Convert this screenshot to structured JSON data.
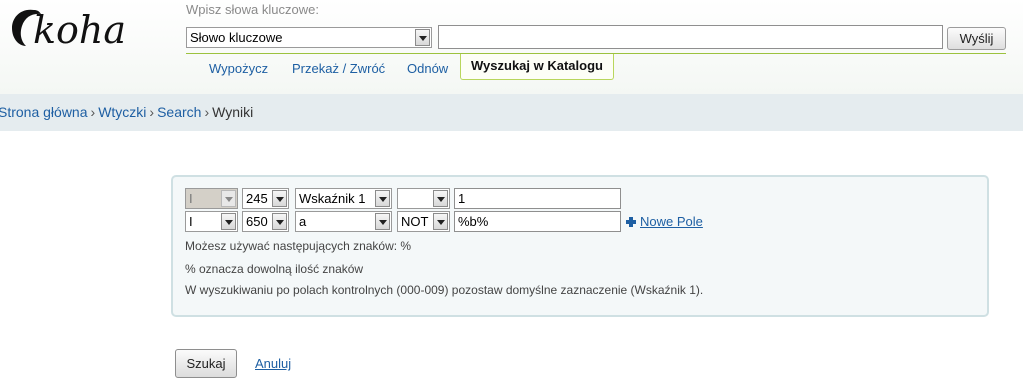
{
  "header": {
    "logo_text": "koha",
    "search_hint": "Wpisz słowa kluczowe:",
    "search_type_selected": "Słowo kluczowe",
    "keyword_value": "",
    "submit_label": "Wyślij",
    "tabs": [
      "Wypożycz",
      "Przekaż / Zwróć",
      "Odnów",
      "Wyszukaj w Katalogu"
    ],
    "active_tab": "Wyszukaj w Katalogu"
  },
  "breadcrumb": {
    "items": [
      "Strona główna",
      "Wtyczki",
      "Search"
    ],
    "current": "Wyniki",
    "separator": "›"
  },
  "criteria": [
    {
      "logic": "I",
      "logic_disabled": true,
      "field": "245",
      "subfield": "Wskaźnik 1",
      "operator": "",
      "value": "1"
    },
    {
      "logic": "I",
      "logic_disabled": false,
      "field": "650",
      "subfield": "a",
      "operator": "NOT",
      "value": "%b%"
    }
  ],
  "add_field_label": "Nowe Pole",
  "help_lines": [
    "Możesz używać następujących znaków: %",
    "% oznacza dowolną ilość znaków",
    "W wyszukiwaniu po polach kontrolnych (000-009) pozostaw domyślne zaznaczenie (Wskaźnik 1)."
  ],
  "actions": {
    "search_label": "Szukaj",
    "cancel_label": "Anuluj"
  },
  "colors": {
    "link": "#1e5fa3",
    "tab_accent": "#9cc23e",
    "breadcrumb_bg": "#e5ecef",
    "panel_border": "#cfe0e3"
  }
}
